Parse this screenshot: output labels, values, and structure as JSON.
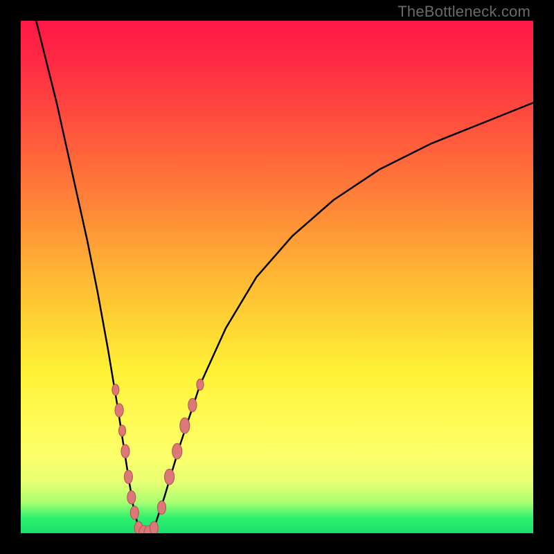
{
  "watermark": "TheBottleneck.com",
  "chart_data": {
    "type": "line",
    "title": "",
    "xlabel": "",
    "ylabel": "",
    "xlim": [
      0,
      100
    ],
    "ylim": [
      0,
      100
    ],
    "grid": false,
    "series": [
      {
        "name": "bottleneck-curve",
        "x": [
          3,
          5,
          7,
          9,
          11,
          13,
          15,
          17,
          19,
          21,
          22,
          23,
          24,
          25,
          26,
          28,
          31,
          35,
          40,
          46,
          53,
          61,
          70,
          80,
          90,
          100
        ],
        "y": [
          100,
          92,
          84,
          75,
          66,
          57,
          47,
          36,
          24,
          11,
          5,
          1,
          0,
          0,
          1,
          7,
          17,
          29,
          40,
          50,
          58,
          65,
          71,
          76,
          80,
          84
        ]
      }
    ],
    "markers": {
      "name": "highlight-points",
      "points": [
        {
          "x": 18.5,
          "y": 28,
          "r": 5
        },
        {
          "x": 19.2,
          "y": 24,
          "r": 6
        },
        {
          "x": 19.8,
          "y": 20,
          "r": 5
        },
        {
          "x": 20.4,
          "y": 16,
          "r": 6
        },
        {
          "x": 21.0,
          "y": 11,
          "r": 6
        },
        {
          "x": 21.6,
          "y": 7,
          "r": 6
        },
        {
          "x": 22.2,
          "y": 4,
          "r": 6
        },
        {
          "x": 23.0,
          "y": 1,
          "r": 6
        },
        {
          "x": 24.0,
          "y": 0,
          "r": 7
        },
        {
          "x": 25.0,
          "y": 0,
          "r": 7
        },
        {
          "x": 26.0,
          "y": 1,
          "r": 6
        },
        {
          "x": 27.5,
          "y": 5,
          "r": 6
        },
        {
          "x": 29.0,
          "y": 11,
          "r": 7
        },
        {
          "x": 30.5,
          "y": 16,
          "r": 7
        },
        {
          "x": 32.0,
          "y": 21,
          "r": 7
        },
        {
          "x": 33.5,
          "y": 25,
          "r": 6
        },
        {
          "x": 35.0,
          "y": 29,
          "r": 5
        }
      ]
    },
    "background_gradient": {
      "top": "#ff1846",
      "mid": "#fff035",
      "bottom": "#1ae06a"
    }
  }
}
